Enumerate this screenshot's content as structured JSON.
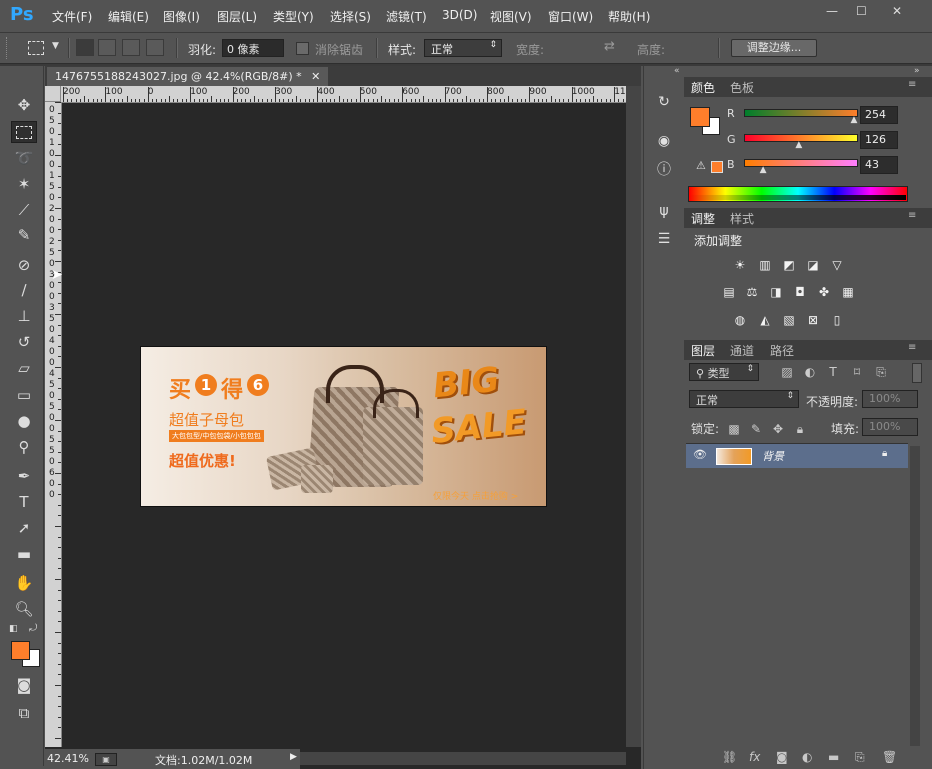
{
  "menubar": {
    "logo": "Ps",
    "items": [
      "文件(F)",
      "编辑(E)",
      "图像(I)",
      "图层(L)",
      "类型(Y)",
      "选择(S)",
      "滤镜(T)",
      "3D(D)",
      "视图(V)",
      "窗口(W)",
      "帮助(H)"
    ],
    "minimize": "—",
    "maximize": "☐",
    "close": "✕"
  },
  "options": {
    "feather_label": "羽化:",
    "feather_value": "0 像素",
    "antialias_label": "消除锯齿",
    "style_label": "样式:",
    "style_value": "正常",
    "width_label": "宽度:",
    "height_label": "高度:",
    "refine_edge": "调整边缘..."
  },
  "document": {
    "tab_title": "1476755188243027.jpg @ 42.4%(RGB/8#) *",
    "tab_close": "✕",
    "ruler_h": [
      "200",
      "100",
      "0",
      "100",
      "200",
      "300",
      "400",
      "500",
      "600",
      "700",
      "800",
      "900",
      "1000",
      "110"
    ],
    "ruler_v": [
      "0",
      "5",
      "0",
      "1",
      "0",
      "0",
      "1",
      "5",
      "0",
      "2",
      "0",
      "0",
      "2",
      "5",
      "0",
      "3",
      "0",
      "0",
      "3",
      "5",
      "0",
      "4",
      "0",
      "0",
      "4",
      "5",
      "0",
      "5",
      "0",
      "0",
      "5",
      "5",
      "0",
      "6",
      "0",
      "0"
    ],
    "zoom": "42.41%",
    "doc_info": "文档:1.02M/1.02M"
  },
  "banner": {
    "buy": "买",
    "buy_num": "1",
    "get": "得",
    "get_num": "6",
    "line2": "超值子母包",
    "line3": "大包包型/中包包袋/小包包包",
    "line4": "超值优惠!",
    "big": "BIG",
    "sale": "SALE",
    "footer": "仅限今天 点击抢购 >"
  },
  "color_panel": {
    "tab_active": "颜色",
    "tab_other": "色板",
    "r_label": "R",
    "g_label": "G",
    "b_label": "B",
    "r_value": "254",
    "g_value": "126",
    "b_value": "43",
    "r_fraction": 0.996,
    "g_fraction": 0.494,
    "b_fraction": 0.169,
    "fg_color": "#fe7e2b"
  },
  "adjust_panel": {
    "tab_active": "调整",
    "tab_other": "样式",
    "add_label": "添加调整"
  },
  "layers_panel": {
    "tab_active": "图层",
    "tab_channels": "通道",
    "tab_paths": "路径",
    "filter_type": "类型",
    "blend_mode": "正常",
    "opacity_label": "不透明度:",
    "opacity_value": "100%",
    "lock_label": "锁定:",
    "fill_label": "填充:",
    "fill_value": "100%",
    "layer_name": "背景"
  }
}
